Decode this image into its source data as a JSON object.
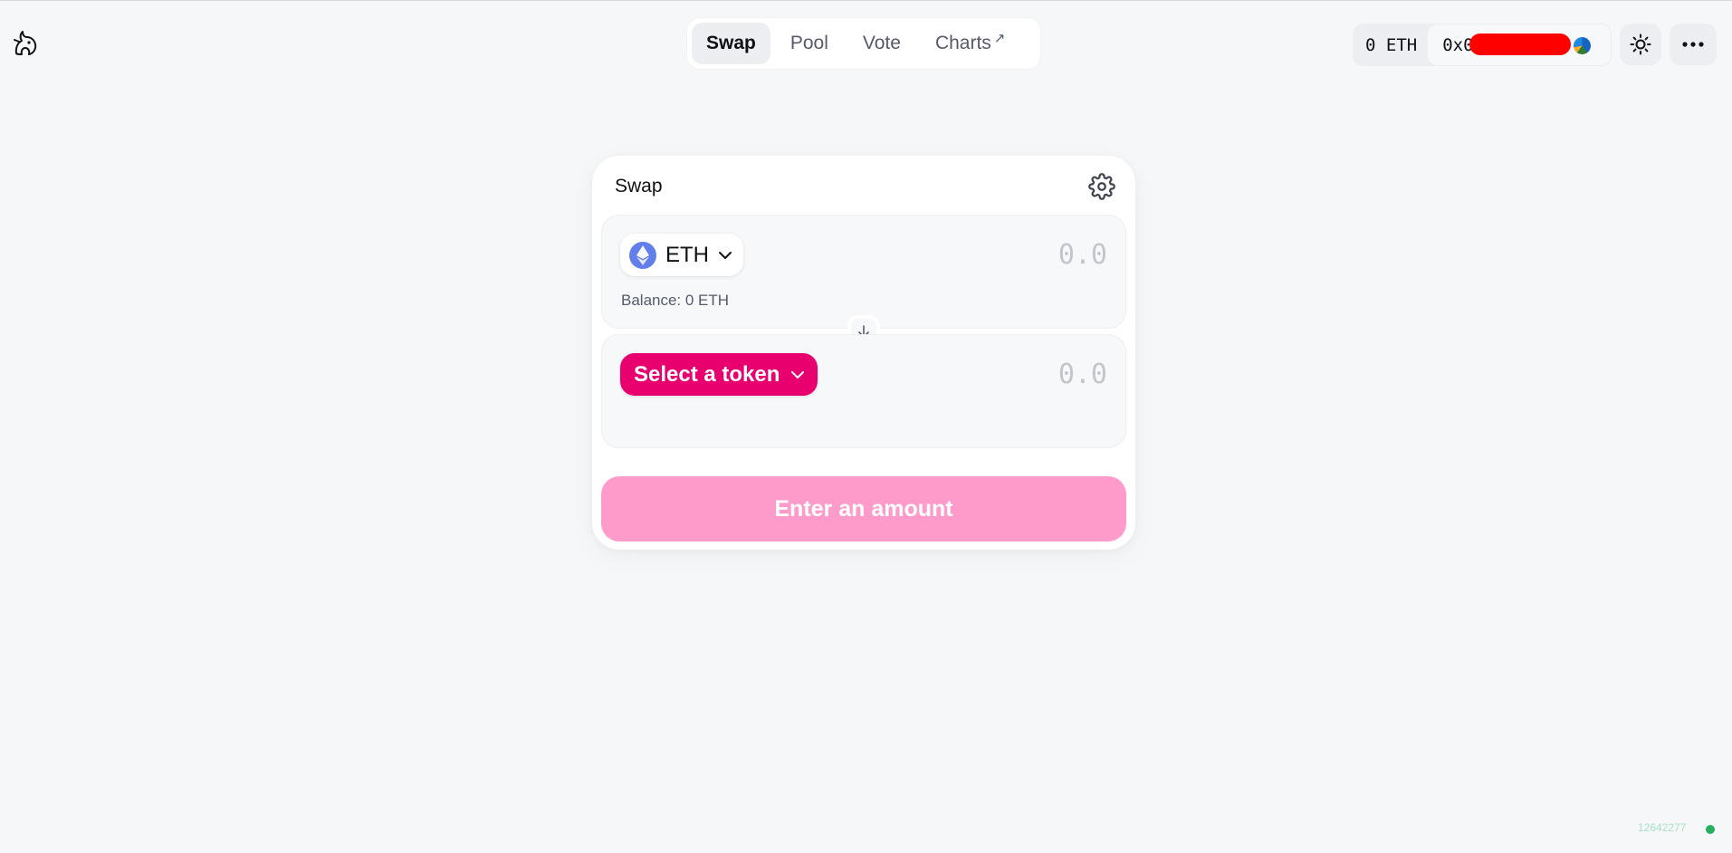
{
  "nav": {
    "items": [
      {
        "label": "Swap"
      },
      {
        "label": "Pool"
      },
      {
        "label": "Vote"
      },
      {
        "label": "Charts",
        "external_mark": "↗"
      }
    ]
  },
  "account": {
    "balance": "0 ETH",
    "address_prefix": "0x0"
  },
  "swap": {
    "title": "Swap",
    "input": {
      "token": "ETH",
      "placeholder": "0.0",
      "balance_label": "Balance: 0 ETH"
    },
    "output": {
      "select_label": "Select a token",
      "placeholder": "0.0"
    },
    "cta_label": "Enter an amount"
  },
  "footer": {
    "block_number": "12642277"
  },
  "colors": {
    "accent_pink": "#e8006f",
    "cta_disabled_pink": "#ff9bcb",
    "eth_blue": "#627eea",
    "status_green": "#27ae60"
  },
  "icons": [
    "unicorn-logo-icon",
    "external-link-icon",
    "identicon-icon",
    "sun-icon",
    "more-dots-icon",
    "settings-gear-icon",
    "eth-icon",
    "chevron-down-icon",
    "arrow-down-icon"
  ]
}
